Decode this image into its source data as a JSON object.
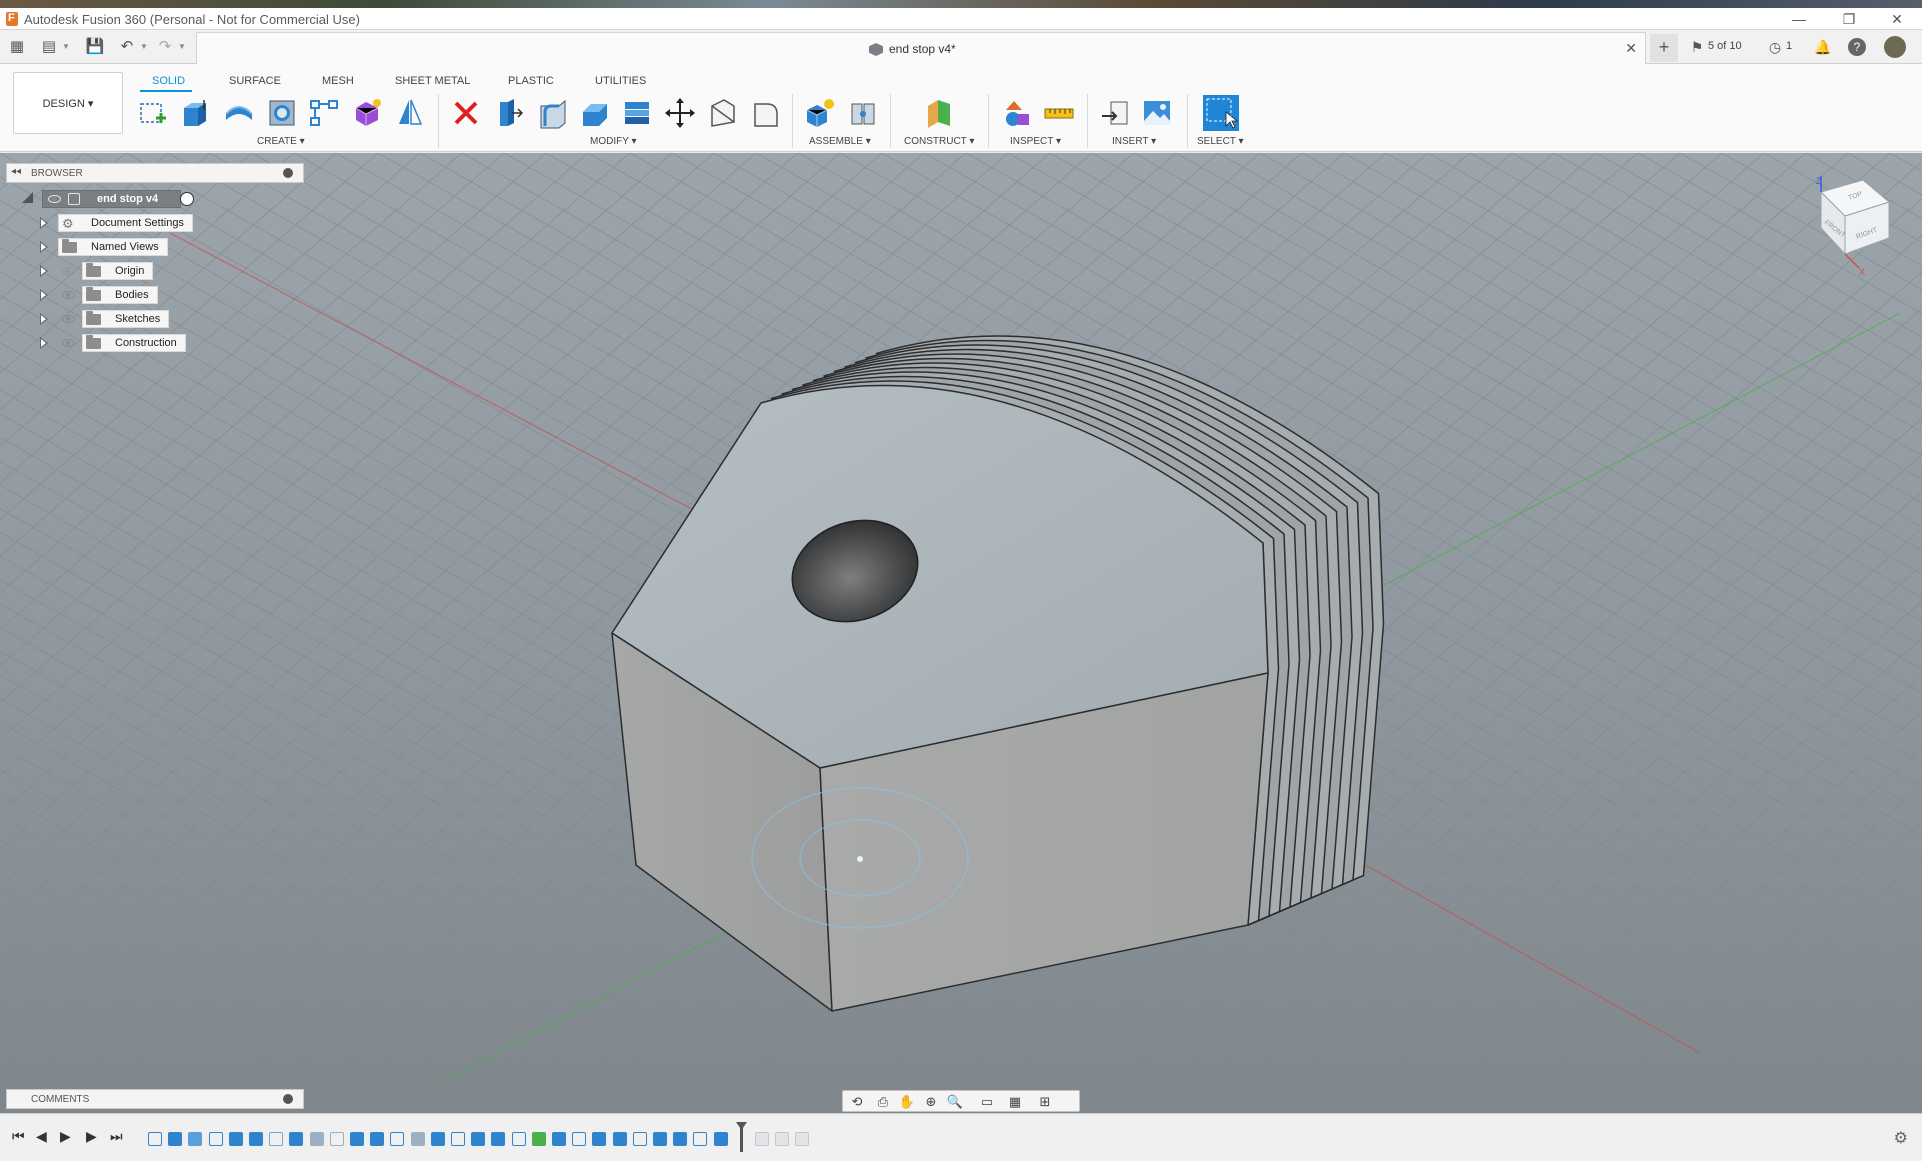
{
  "titlebar": {
    "title": "Autodesk Fusion 360 (Personal - Not for Commercial Use)",
    "minimize": "—",
    "restore": "❐",
    "close": "✕"
  },
  "tabbar": {
    "doc_title": "end stop v4*",
    "close": "✕",
    "new_tab": "+",
    "jobs": "5 of 10",
    "clock_count": "1",
    "help": "?"
  },
  "toolbar": {
    "workspace": "DESIGN ▾",
    "tabs": [
      "SOLID",
      "SURFACE",
      "MESH",
      "SHEET METAL",
      "PLASTIC",
      "UTILITIES"
    ],
    "groups": [
      "CREATE ▾",
      "MODIFY ▾",
      "ASSEMBLE ▾",
      "CONSTRUCT ▾",
      "INSPECT ▾",
      "INSERT ▾",
      "SELECT ▾"
    ]
  },
  "browser": {
    "title": "BROWSER",
    "root": "end stop v4",
    "items": [
      {
        "label": "Document Settings",
        "icon": "gear-icon"
      },
      {
        "label": "Named Views",
        "icon": "folder-icon"
      },
      {
        "label": "Origin",
        "icon": "folder-icon"
      },
      {
        "label": "Bodies",
        "icon": "folder-icon"
      },
      {
        "label": "Sketches",
        "icon": "folder-icon"
      },
      {
        "label": "Construction",
        "icon": "folder-icon"
      }
    ]
  },
  "comments": {
    "title": "COMMENTS"
  },
  "viewcube": {
    "top": "TOP",
    "front": "FRONT",
    "right": "RIGHT",
    "axis_z": "Z",
    "axis_x": "X"
  },
  "colors": {
    "accent": "#0696d7",
    "body": "#a9aeb1",
    "viewport": "#8e979d"
  }
}
